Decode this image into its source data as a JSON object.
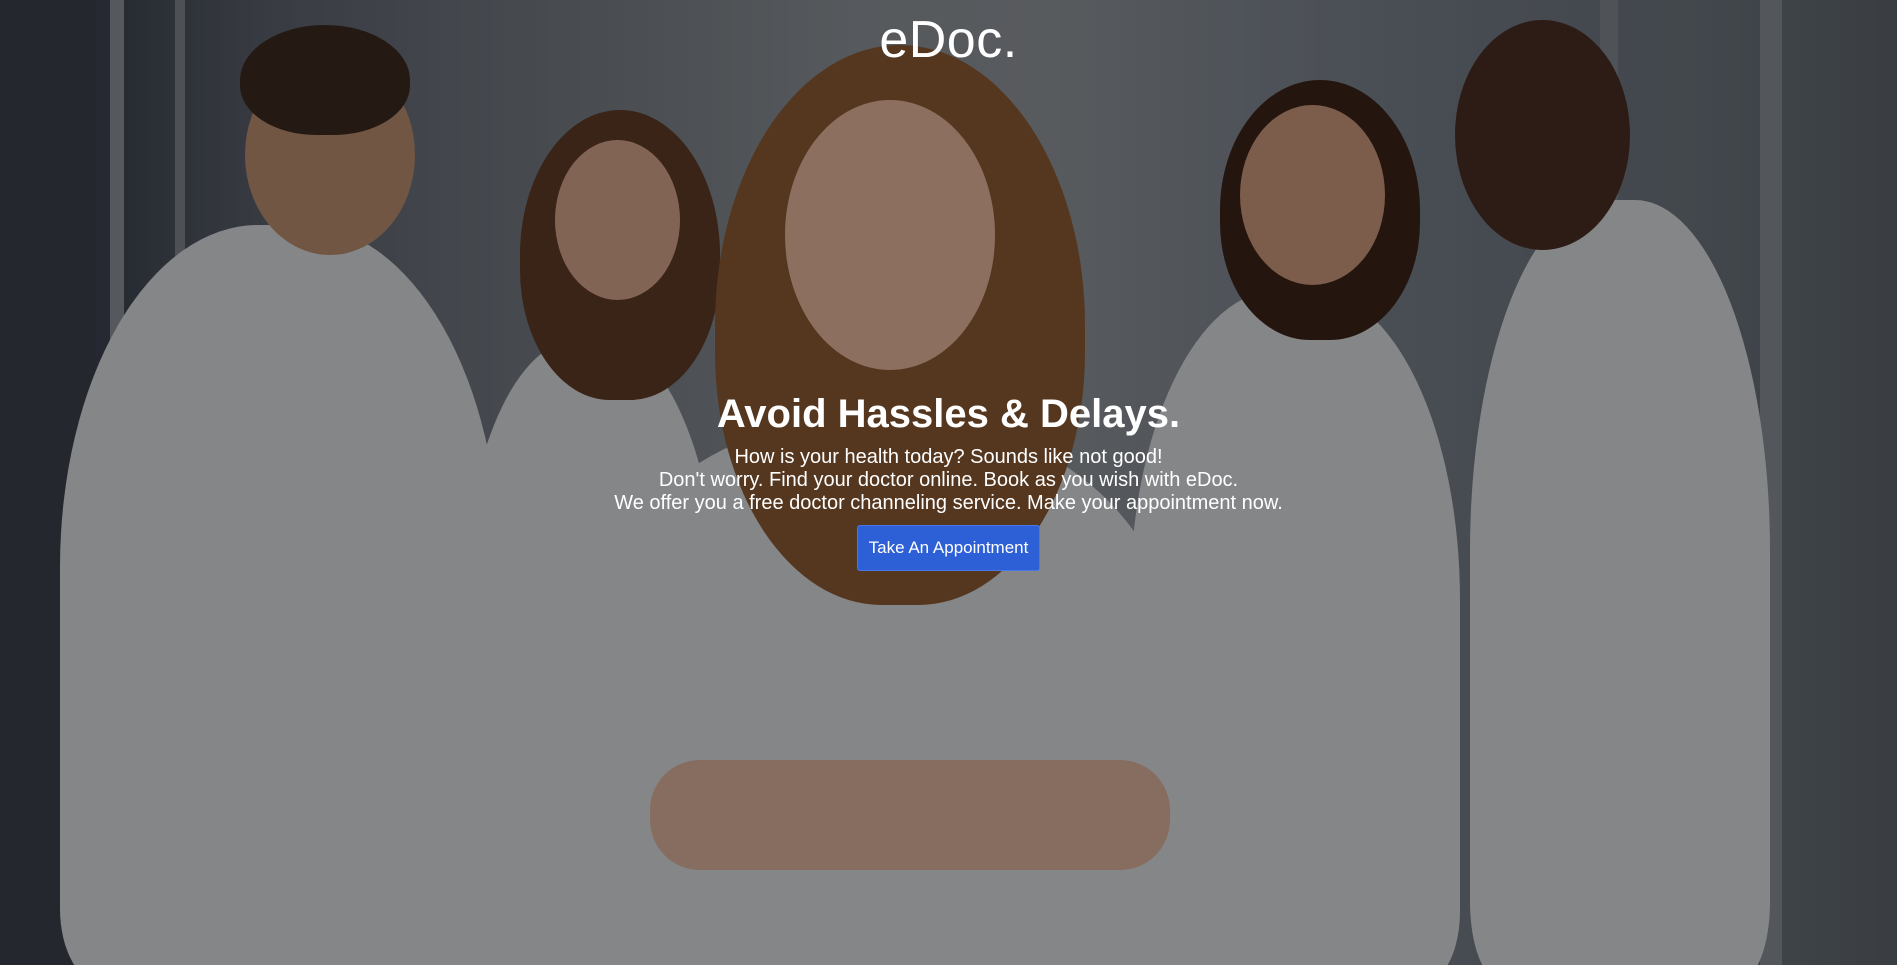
{
  "brand": {
    "logo_text": "eDoc."
  },
  "hero": {
    "headline": "Avoid Hassles & Delays.",
    "description_lines": [
      "How is your health today? Sounds like not good!",
      "Don't worry. Find your doctor online. Book as you wish with eDoc.",
      "We offer you a free doctor channeling service. Make your appointment now."
    ],
    "cta_label": "Take An Appointment",
    "background": "photo of smiling medical staff in white coats in a hospital corridor"
  },
  "colors": {
    "cta_background": "#2d5fd6",
    "text": "#ffffff",
    "overlay": "rgba(0,0,0,0.38)"
  }
}
